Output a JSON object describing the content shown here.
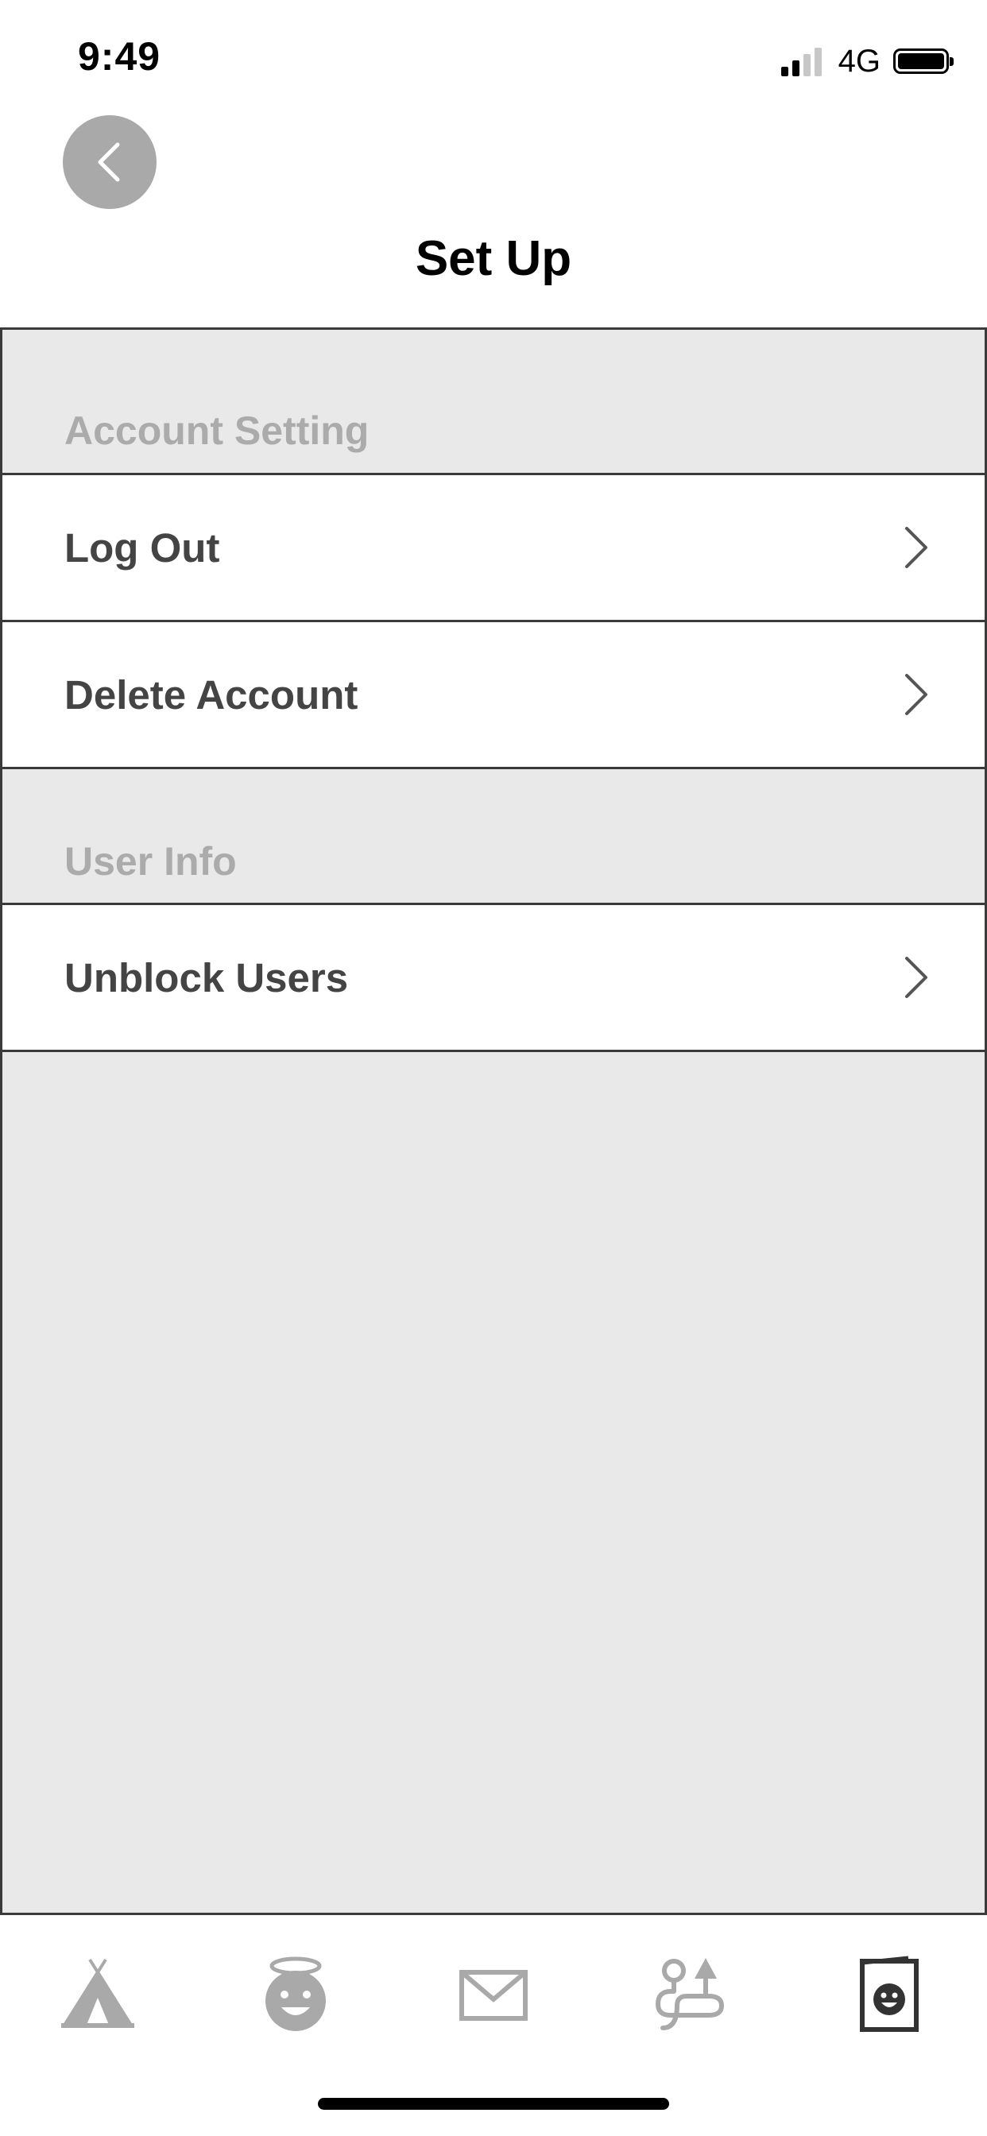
{
  "status_bar": {
    "time": "9:49",
    "network": "4G"
  },
  "header": {
    "title": "Set Up",
    "back_icon": "chevron-left-icon"
  },
  "sections": [
    {
      "title": "Account Setting",
      "items": [
        {
          "label": "Log Out",
          "icon": "chevron-right-icon"
        },
        {
          "label": "Delete Account",
          "icon": "chevron-right-icon"
        }
      ]
    },
    {
      "title": "User Info",
      "items": [
        {
          "label": "Unblock Users",
          "icon": "chevron-right-icon"
        }
      ]
    }
  ],
  "tab_bar": {
    "tabs": [
      {
        "icon": "tent-icon",
        "active": false
      },
      {
        "icon": "angel-face-icon",
        "active": false
      },
      {
        "icon": "mail-icon",
        "active": false
      },
      {
        "icon": "route-icon",
        "active": false
      },
      {
        "icon": "profile-card-icon",
        "active": true
      }
    ]
  },
  "colors": {
    "content_background": "#e9e9e9",
    "divider": "#3a3a3a",
    "section_header_text": "#ababab",
    "row_text": "#444444",
    "inactive_icon": "#a9a9a9",
    "active_icon": "#333333"
  }
}
